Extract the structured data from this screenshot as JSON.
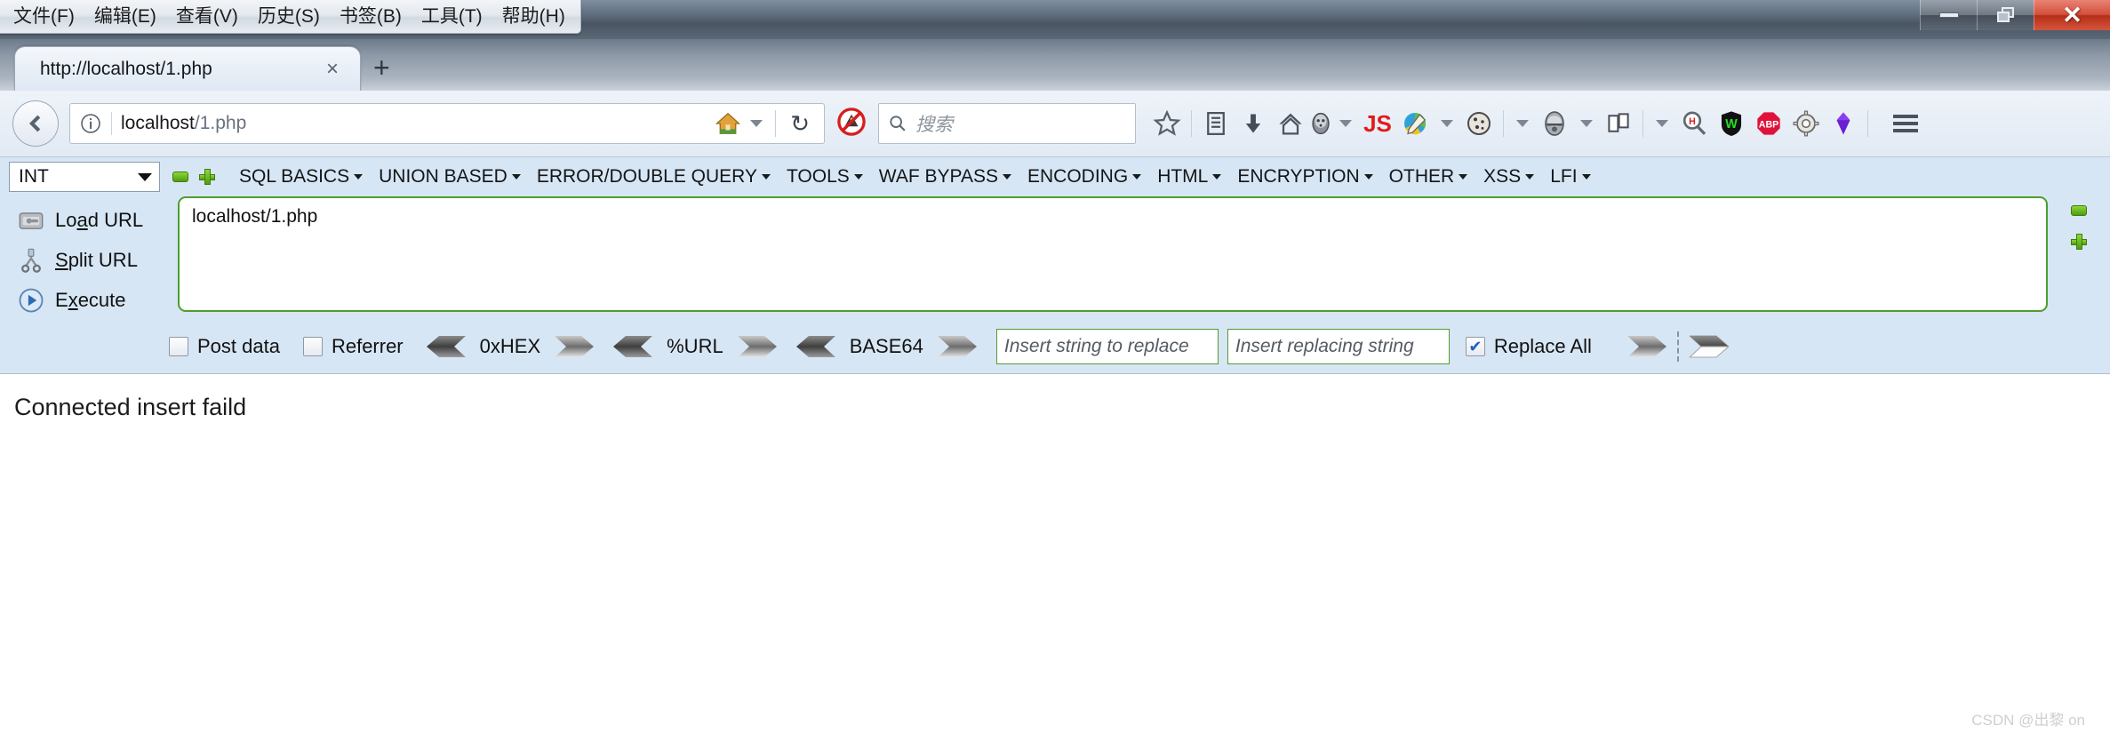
{
  "window": {
    "menu_items": [
      "文件(F)",
      "编辑(E)",
      "查看(V)",
      "历史(S)",
      "书签(B)",
      "工具(T)",
      "帮助(H)"
    ],
    "controls": {
      "minimize": "minimize",
      "restore": "restore",
      "close": "✕"
    }
  },
  "tabs": {
    "items": [
      {
        "title": "http://localhost/1.php",
        "close": "×"
      }
    ],
    "new_tab": "+"
  },
  "navbar": {
    "back_tooltip": "Back",
    "url": "localhost/1.php",
    "url_host": "localhost",
    "url_path": "/1.php",
    "reload": "↻",
    "search_placeholder": "搜索",
    "icons": [
      "star-icon",
      "library-icon",
      "downloads-icon",
      "home-icon",
      "anonymous-icon",
      "js-toggle-icon",
      "colorzilla-icon",
      "cookie-icon",
      "useragent-icon",
      "devtools-icon",
      "hackbar-search-icon",
      "wappalyzer-icon",
      "adblock-icon",
      "gear-icon",
      "diamond-icon"
    ]
  },
  "hackbar": {
    "type_select": "INT",
    "menus": [
      "SQL BASICS",
      "UNION BASED",
      "ERROR/DOUBLE QUERY",
      "TOOLS",
      "WAF BYPASS",
      "ENCODING",
      "HTML",
      "ENCRYPTION",
      "OTHER",
      "XSS",
      "LFI"
    ],
    "actions": [
      {
        "id": "load-url",
        "pre": "Lo",
        "key": "a",
        "post": "d URL"
      },
      {
        "id": "split-url",
        "pre": "",
        "key": "S",
        "post": "plit URL"
      },
      {
        "id": "execute",
        "pre": "E",
        "key": "x",
        "post": "ecute"
      }
    ],
    "url_value": "localhost/1.php",
    "side_buttons": [
      "minus-button",
      "plus-button"
    ],
    "options": {
      "post_data": {
        "label": "Post data",
        "checked": false
      },
      "referrer": {
        "label": "Referrer",
        "checked": false
      },
      "encoders": [
        "0xHEX",
        "%URL",
        "BASE64"
      ],
      "replace_from_placeholder": "Insert string to replace",
      "replace_to_placeholder": "Insert replacing string",
      "replace_all": {
        "label": "Replace All",
        "checked": true
      }
    }
  },
  "page": {
    "text": "Connected insert faild"
  },
  "watermark": "CSDN @出黎 on",
  "colors": {
    "hackbar_bg": "#d7e6f5",
    "hackbar_border_green": "#4e9e2e",
    "close_button_red": "#c0392b",
    "accent_green": "#4e9e0e"
  }
}
